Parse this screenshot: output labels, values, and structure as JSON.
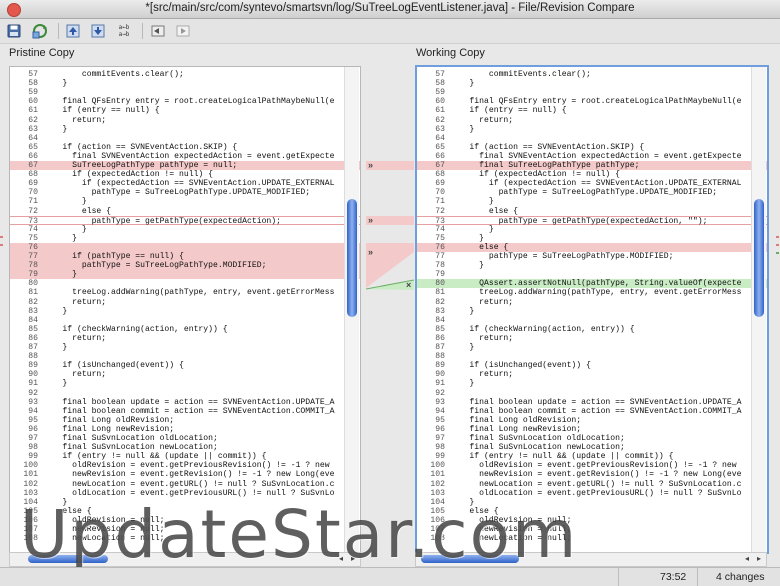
{
  "window": {
    "title": "*[src/main/src/com/syntevo/smartsvn/log/SuTreeLogEventListener.java] - File/Revision Compare"
  },
  "toolbar": {
    "icons": [
      "save-icon",
      "refresh-icon",
      "previous-change-icon",
      "next-change-icon",
      "ab-compare-icon",
      "take-left-icon",
      "take-right-icon"
    ],
    "ab_top": "a←b",
    "ab_bottom": "a→b"
  },
  "panels": {
    "left_title": "Pristine Copy",
    "right_title": "Working Copy"
  },
  "colors": {
    "deleted": "#f4c9c9",
    "added": "#c9ecc5",
    "scroll_thumb": "#2f62c9",
    "active_border": "#6e9edb"
  },
  "left_lines": [
    {
      "n": "57",
      "t": "        commitEvents.clear();"
    },
    {
      "n": "58",
      "t": "    }"
    },
    {
      "n": "59",
      "t": ""
    },
    {
      "n": "60",
      "t": "    final QFsEntry entry = root.createLogicalPathMaybeNull(e"
    },
    {
      "n": "61",
      "t": "    if (entry == null) {"
    },
    {
      "n": "62",
      "t": "      return;"
    },
    {
      "n": "63",
      "t": "    }"
    },
    {
      "n": "64",
      "t": ""
    },
    {
      "n": "65",
      "t": "    if (action == SVNEventAction.SKIP) {"
    },
    {
      "n": "66",
      "t": "      final SVNEventAction expectedAction = event.getExpecte"
    },
    {
      "n": "67",
      "t": "      SuTreeLogPathType pathType = null;",
      "c": "del"
    },
    {
      "n": "68",
      "t": "      if (expectedAction != null) {"
    },
    {
      "n": "69",
      "t": "        if (expectedAction == SVNEventAction.UPDATE_EXTERNAL"
    },
    {
      "n": "70",
      "t": "          pathType = SuTreeLogPathType.UPDATE_MODIFIED;"
    },
    {
      "n": "71",
      "t": "        }"
    },
    {
      "n": "72",
      "t": "        else {"
    },
    {
      "n": "73",
      "t": "          pathType = getPathType(expectedAction);",
      "c": "box"
    },
    {
      "n": "74",
      "t": "        }"
    },
    {
      "n": "75",
      "t": "      }"
    },
    {
      "n": "76",
      "t": "",
      "c": "del"
    },
    {
      "n": "77",
      "t": "      if (pathType == null) {",
      "c": "del"
    },
    {
      "n": "78",
      "t": "        pathType = SuTreeLogPathType.MODIFIED;",
      "c": "del"
    },
    {
      "n": "79",
      "t": "      }",
      "c": "del"
    },
    {
      "n": "80",
      "t": ""
    },
    {
      "n": "81",
      "t": "      treeLog.addWarning(pathType, entry, event.getErrorMess"
    },
    {
      "n": "82",
      "t": "      return;"
    },
    {
      "n": "83",
      "t": "    }"
    },
    {
      "n": "84",
      "t": ""
    },
    {
      "n": "85",
      "t": "    if (checkWarning(action, entry)) {"
    },
    {
      "n": "86",
      "t": "      return;"
    },
    {
      "n": "87",
      "t": "    }"
    },
    {
      "n": "88",
      "t": ""
    },
    {
      "n": "89",
      "t": "    if (isUnchanged(event)) {"
    },
    {
      "n": "90",
      "t": "      return;"
    },
    {
      "n": "91",
      "t": "    }"
    },
    {
      "n": "92",
      "t": ""
    },
    {
      "n": "93",
      "t": "    final boolean update = action == SVNEventAction.UPDATE_A"
    },
    {
      "n": "94",
      "t": "    final boolean commit = action == SVNEventAction.COMMIT_A"
    },
    {
      "n": "95",
      "t": "    final Long oldRevision;"
    },
    {
      "n": "96",
      "t": "    final Long newRevision;"
    },
    {
      "n": "97",
      "t": "    final SuSvnLocation oldLocation;"
    },
    {
      "n": "98",
      "t": "    final SuSvnLocation newLocation;"
    },
    {
      "n": "99",
      "t": "    if (entry != null && (update || commit)) {"
    },
    {
      "n": "100",
      "t": "      oldRevision = event.getPreviousRevision() != -1 ? new"
    },
    {
      "n": "101",
      "t": "      newRevision = event.getRevision() != -1 ? new Long(eve"
    },
    {
      "n": "102",
      "t": "      newLocation = event.getURL() != null ? SuSvnLocation.c"
    },
    {
      "n": "103",
      "t": "      oldLocation = event.getPreviousURL() != null ? SuSvnLo"
    },
    {
      "n": "104",
      "t": "    }"
    },
    {
      "n": "105",
      "t": "    else {"
    },
    {
      "n": "106",
      "t": "      oldRevision = null;"
    },
    {
      "n": "107",
      "t": "      newRevision = null;"
    },
    {
      "n": "108",
      "t": "      newLocation = null;"
    }
  ],
  "right_lines": [
    {
      "n": "57",
      "t": "        commitEvents.clear();"
    },
    {
      "n": "58",
      "t": "    }"
    },
    {
      "n": "59",
      "t": ""
    },
    {
      "n": "60",
      "t": "    final QFsEntry entry = root.createLogicalPathMaybeNull(e"
    },
    {
      "n": "61",
      "t": "    if (entry == null) {"
    },
    {
      "n": "62",
      "t": "      return;"
    },
    {
      "n": "63",
      "t": "    }"
    },
    {
      "n": "64",
      "t": ""
    },
    {
      "n": "65",
      "t": "    if (action == SVNEventAction.SKIP) {"
    },
    {
      "n": "66",
      "t": "      final SVNEventAction expectedAction = event.getExpecte"
    },
    {
      "n": "67",
      "t": "      final SuTreeLogPathType pathType;",
      "c": "del"
    },
    {
      "n": "68",
      "t": "      if (expectedAction != null) {"
    },
    {
      "n": "69",
      "t": "        if (expectedAction == SVNEventAction.UPDATE_EXTERNAL"
    },
    {
      "n": "70",
      "t": "          pathType = SuTreeLogPathType.UPDATE_MODIFIED;"
    },
    {
      "n": "71",
      "t": "        }"
    },
    {
      "n": "72",
      "t": "        else {"
    },
    {
      "n": "73",
      "t": "          pathType = getPathType(expectedAction, \"\");",
      "c": "box"
    },
    {
      "n": "74",
      "t": "        }"
    },
    {
      "n": "75",
      "t": "      }"
    },
    {
      "n": "76",
      "t": "      else {",
      "c": "del"
    },
    {
      "n": "77",
      "t": "        pathType = SuTreeLogPathType.MODIFIED;"
    },
    {
      "n": "78",
      "t": "      }"
    },
    {
      "n": "79",
      "t": ""
    },
    {
      "n": "80",
      "t": "      QAssert.assertNotNull(pathType, String.valueOf(expecte",
      "c": "add"
    },
    {
      "n": "81",
      "t": "      treeLog.addWarning(pathType, entry, event.getErrorMess"
    },
    {
      "n": "82",
      "t": "      return;"
    },
    {
      "n": "83",
      "t": "    }"
    },
    {
      "n": "84",
      "t": ""
    },
    {
      "n": "85",
      "t": "    if (checkWarning(action, entry)) {"
    },
    {
      "n": "86",
      "t": "      return;"
    },
    {
      "n": "87",
      "t": "    }"
    },
    {
      "n": "88",
      "t": ""
    },
    {
      "n": "89",
      "t": "    if (isUnchanged(event)) {"
    },
    {
      "n": "90",
      "t": "      return;"
    },
    {
      "n": "91",
      "t": "    }"
    },
    {
      "n": "92",
      "t": ""
    },
    {
      "n": "93",
      "t": "    final boolean update = action == SVNEventAction.UPDATE_A"
    },
    {
      "n": "94",
      "t": "    final boolean commit = action == SVNEventAction.COMMIT_A"
    },
    {
      "n": "95",
      "t": "    final Long oldRevision;"
    },
    {
      "n": "96",
      "t": "    final Long newRevision;"
    },
    {
      "n": "97",
      "t": "    final SuSvnLocation oldLocation;"
    },
    {
      "n": "98",
      "t": "    final SuSvnLocation newLocation;"
    },
    {
      "n": "99",
      "t": "    if (entry != null && (update || commit)) {"
    },
    {
      "n": "100",
      "t": "      oldRevision = event.getPreviousRevision() != -1 ? new"
    },
    {
      "n": "101",
      "t": "      newRevision = event.getRevision() != -1 ? new Long(eve"
    },
    {
      "n": "102",
      "t": "      newLocation = event.getURL() != null ? SuSvnLocation.c"
    },
    {
      "n": "103",
      "t": "      oldLocation = event.getPreviousURL() != null ? SuSvnLo"
    },
    {
      "n": "104",
      "t": "    }"
    },
    {
      "n": "105",
      "t": "    else {"
    },
    {
      "n": "106",
      "t": "      oldRevision = null;"
    },
    {
      "n": "107",
      "t": "      newRevision = null;"
    },
    {
      "n": "108",
      "t": "      newLocation = null;"
    }
  ],
  "middle": {
    "take_right": "»",
    "take_x": "×"
  },
  "status": {
    "position": "73:52",
    "changes": "4 changes"
  },
  "watermark": "UpdateStar.com"
}
